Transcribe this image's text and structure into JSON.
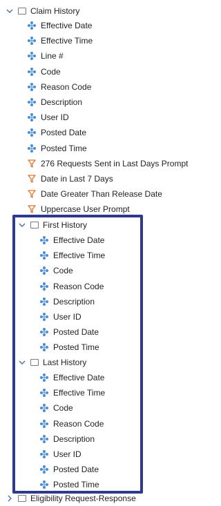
{
  "tree": {
    "claim_history": {
      "label": "Claim History",
      "fields": [
        "Effective Date",
        "Effective Time",
        "Line #",
        "Code",
        "Reason Code",
        "Description",
        "User ID",
        "Posted Date",
        "Posted Time"
      ],
      "filters": [
        "276 Requests Sent in Last Days Prompt",
        "Date in Last 7 Days",
        "Date Greater Than Release Date",
        "Uppercase User Prompt"
      ]
    },
    "first_history": {
      "label": "First History",
      "fields": [
        "Effective Date",
        "Effective Time",
        "Code",
        "Reason Code",
        "Description",
        "User ID",
        "Posted Date",
        "Posted Time"
      ]
    },
    "last_history": {
      "label": "Last History",
      "fields": [
        "Effective Date",
        "Effective Time",
        "Code",
        "Reason Code",
        "Description",
        "User ID",
        "Posted Date",
        "Posted Time"
      ]
    },
    "eligibility": {
      "label": "Eligibility Request-Response"
    }
  },
  "icons": {
    "field": "dimension-icon",
    "filter": "filter-icon",
    "folder": "folder-icon"
  },
  "colors": {
    "field_icon": "#4a8bd6",
    "filter_icon": "#e0722a",
    "highlight": "#2f3a8f"
  }
}
